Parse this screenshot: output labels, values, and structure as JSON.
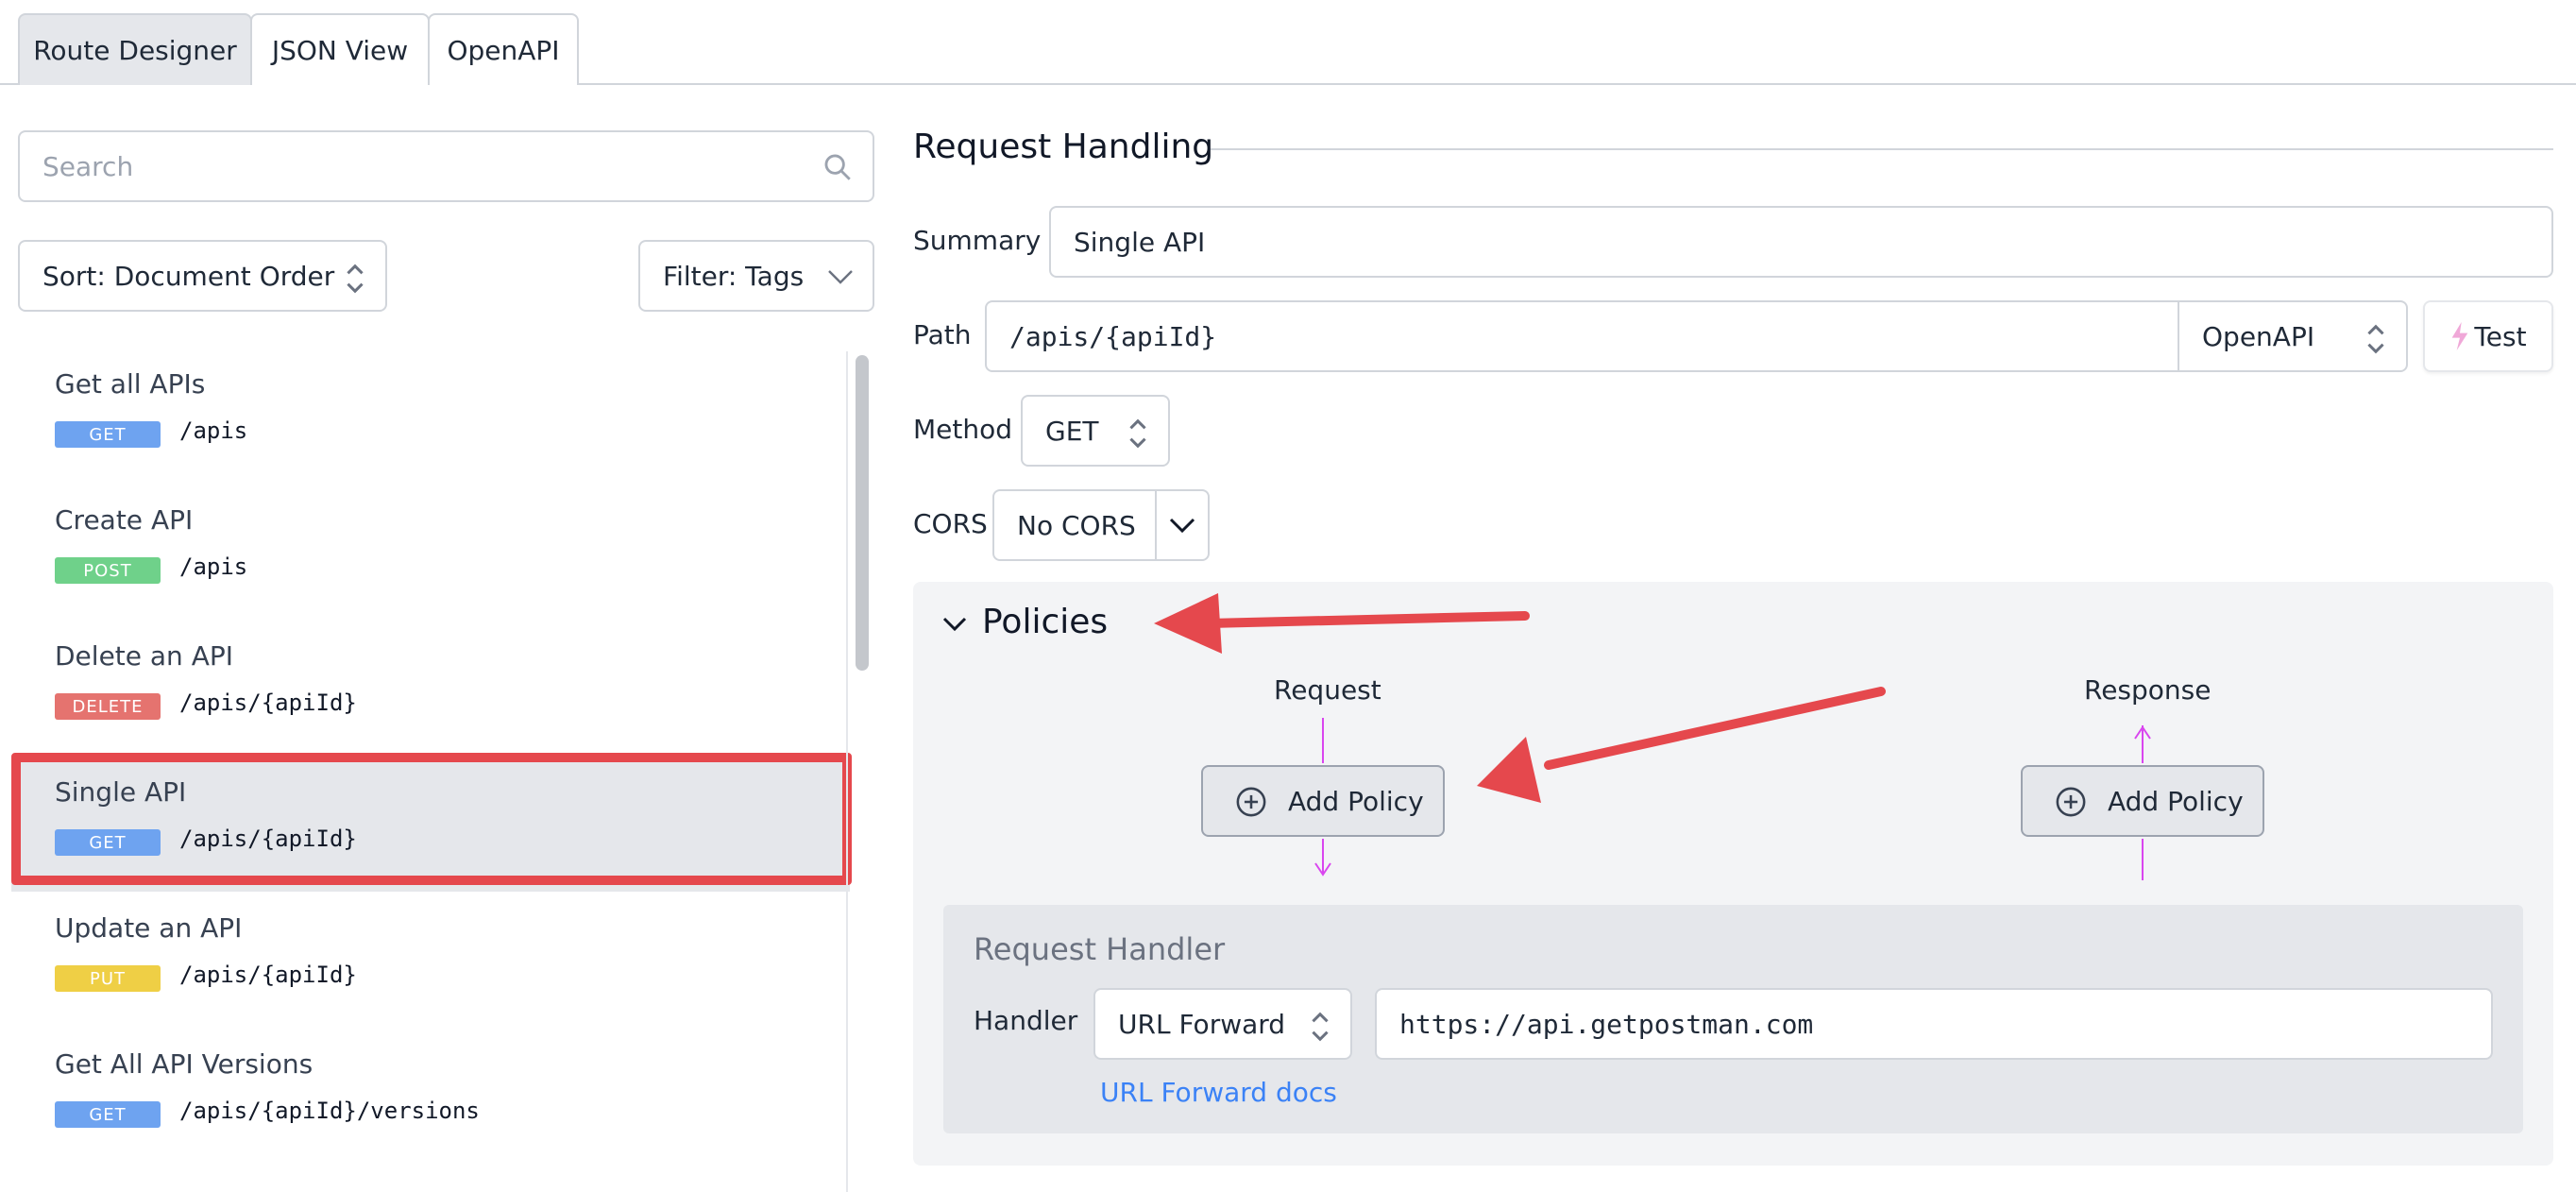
{
  "tabs": [
    {
      "label": "Route Designer",
      "active": true
    },
    {
      "label": "JSON View",
      "active": false
    },
    {
      "label": "OpenAPI",
      "active": false
    }
  ],
  "sidebar": {
    "search_placeholder": "Search",
    "sort_label": "Sort: Document Order",
    "filter_label": "Filter: Tags",
    "routes": [
      {
        "title": "Get all APIs",
        "method": "GET",
        "path": "/apis",
        "color": "#6ea3f0"
      },
      {
        "title": "Create API",
        "method": "POST",
        "path": "/apis",
        "color": "#6fd18a"
      },
      {
        "title": "Delete an API",
        "method": "DELETE",
        "path": "/apis/{apiId}",
        "color": "#e5736f"
      },
      {
        "title": "Single API",
        "method": "GET",
        "path": "/apis/{apiId}",
        "color": "#6ea3f0",
        "selected": true
      },
      {
        "title": "Update an API",
        "method": "PUT",
        "path": "/apis/{apiId}",
        "color": "#efcf45"
      },
      {
        "title": "Get All API Versions",
        "method": "GET",
        "path": "/apis/{apiId}/versions",
        "color": "#6ea3f0"
      }
    ]
  },
  "main": {
    "section_title": "Request Handling",
    "summary_label": "Summary",
    "summary_value": "Single API",
    "path_label": "Path",
    "path_value": "/apis/{apiId}",
    "path_source": "OpenAPI",
    "test_label": "Test",
    "method_label": "Method",
    "method_value": "GET",
    "cors_label": "CORS",
    "cors_value": "No CORS",
    "policies": {
      "title": "Policies",
      "request_label": "Request",
      "response_label": "Response",
      "add_request_label": "Add Policy",
      "add_response_label": "Add Policy"
    },
    "handler": {
      "title": "Request Handler",
      "handler_label": "Handler",
      "handler_type": "URL Forward",
      "handler_url": "https://api.getpostman.com",
      "docs_link": "URL Forward docs"
    }
  },
  "colors": {
    "accent_red": "#e5484d",
    "flow_line": "#d946ef",
    "link": "#3b82f6"
  }
}
